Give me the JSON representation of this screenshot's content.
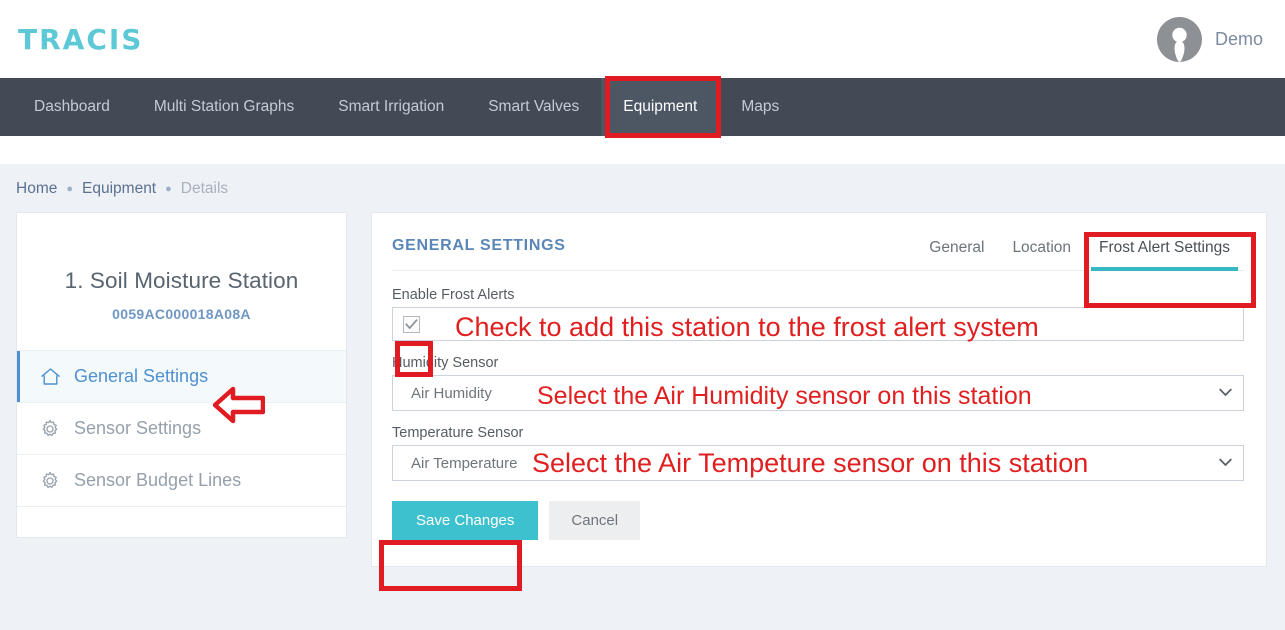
{
  "app": {
    "logo_text": "TRACIS",
    "user_name": "Demo"
  },
  "nav": {
    "items": [
      {
        "label": "Dashboard",
        "active": false
      },
      {
        "label": "Multi Station Graphs",
        "active": false
      },
      {
        "label": "Smart Irrigation",
        "active": false
      },
      {
        "label": "Smart Valves",
        "active": false
      },
      {
        "label": "Equipment",
        "active": true
      },
      {
        "label": "Maps",
        "active": false
      }
    ]
  },
  "breadcrumb": {
    "items": [
      "Home",
      "Equipment",
      "Details"
    ],
    "separator": "●"
  },
  "sidebar": {
    "station_name": "1. Soil Moisture Station",
    "station_serial": "0059AC000018A08A",
    "items": [
      {
        "label": "General Settings",
        "icon": "home-icon",
        "active": true
      },
      {
        "label": "Sensor Settings",
        "icon": "gear-icon",
        "active": false
      },
      {
        "label": "Sensor Budget Lines",
        "icon": "gear-icon",
        "active": false
      }
    ]
  },
  "panel": {
    "title": "GENERAL SETTINGS",
    "tabs": [
      {
        "label": "General",
        "active": false
      },
      {
        "label": "Location",
        "active": false
      },
      {
        "label": "Frost Alert Settings",
        "active": true
      }
    ],
    "fields": {
      "frost_label": "Enable Frost Alerts",
      "frost_checked": true,
      "humidity_label": "Humidity Sensor",
      "humidity_value": "Air Humidity",
      "temperature_label": "Temperature Sensor",
      "temperature_value": "Air Temperature"
    },
    "buttons": {
      "save_label": "Save Changes",
      "cancel_label": "Cancel"
    }
  },
  "annotations": {
    "checkbox_note": "Check to add this station to the frost alert system",
    "humidity_note": "Select the Air Humidity sensor on this station",
    "temperature_note": "Select the Air Tempeture sensor on this station"
  },
  "colors": {
    "accent_teal": "#3ec1ce",
    "logo_cyan": "#5ec9d6",
    "nav_bg": "#424a56",
    "annotation_red": "#e11b22",
    "link_blue": "#4e90d0"
  }
}
